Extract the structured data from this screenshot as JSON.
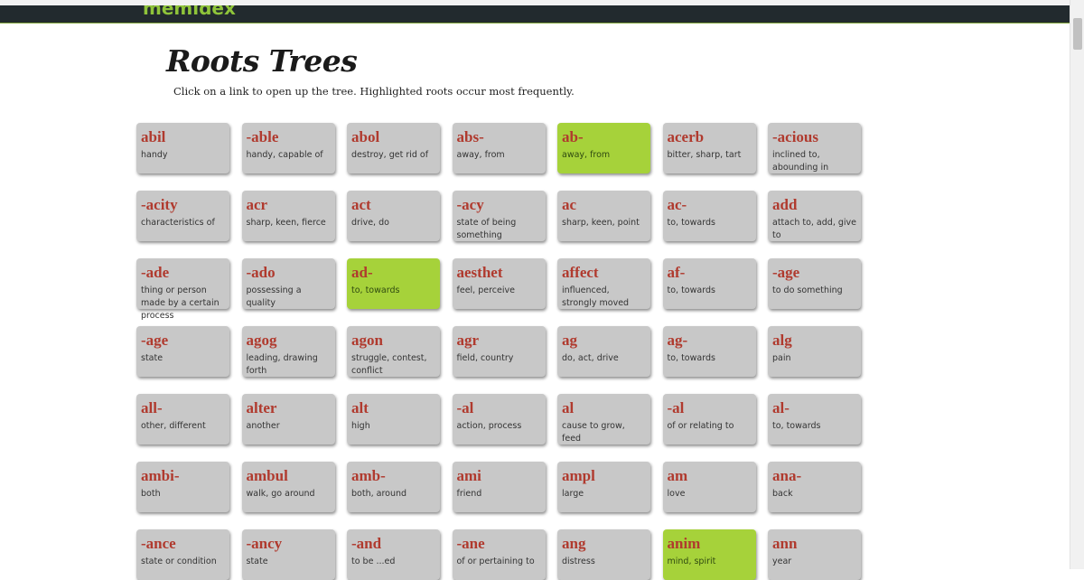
{
  "site": {
    "logo_text": "memidex"
  },
  "page": {
    "title": "Roots Trees",
    "instructions": "Click on a link to open up the tree. Highlighted roots occur most frequently."
  },
  "colors": {
    "card": "#c8c8c8",
    "highlight": "#a6d23a",
    "root_text": "#b03a2e",
    "topbar": "#222a2e"
  },
  "cards": [
    {
      "root": "abil",
      "meaning": "handy",
      "highlighted": false
    },
    {
      "root": "-able",
      "meaning": "handy, capable of",
      "highlighted": false
    },
    {
      "root": "abol",
      "meaning": "destroy, get rid of",
      "highlighted": false
    },
    {
      "root": "abs-",
      "meaning": "away, from",
      "highlighted": false
    },
    {
      "root": "ab-",
      "meaning": "away, from",
      "highlighted": true
    },
    {
      "root": "acerb",
      "meaning": "bitter, sharp, tart",
      "highlighted": false
    },
    {
      "root": "-acious",
      "meaning": "inclined to, abounding in",
      "highlighted": false
    },
    {
      "root": "-acity",
      "meaning": "characteristics of",
      "highlighted": false
    },
    {
      "root": "acr",
      "meaning": "sharp, keen, fierce",
      "highlighted": false
    },
    {
      "root": "act",
      "meaning": "drive, do",
      "highlighted": false
    },
    {
      "root": "-acy",
      "meaning": "state of being something",
      "highlighted": false
    },
    {
      "root": "ac",
      "meaning": "sharp, keen, point",
      "highlighted": false
    },
    {
      "root": "ac-",
      "meaning": "to, towards",
      "highlighted": false
    },
    {
      "root": "add",
      "meaning": "attach to, add, give to",
      "highlighted": false
    },
    {
      "root": "-ade",
      "meaning": "thing or person made by a certain process",
      "highlighted": false
    },
    {
      "root": "-ado",
      "meaning": "possessing a quality",
      "highlighted": false
    },
    {
      "root": "ad-",
      "meaning": "to, towards",
      "highlighted": true
    },
    {
      "root": "aesthet",
      "meaning": "feel, perceive",
      "highlighted": false
    },
    {
      "root": "affect",
      "meaning": "influenced, strongly moved",
      "highlighted": false
    },
    {
      "root": "af-",
      "meaning": "to, towards",
      "highlighted": false
    },
    {
      "root": "-age",
      "meaning": "to do something",
      "highlighted": false
    },
    {
      "root": "-age",
      "meaning": "state",
      "highlighted": false
    },
    {
      "root": "agog",
      "meaning": "leading, drawing forth",
      "highlighted": false
    },
    {
      "root": "agon",
      "meaning": "struggle, contest, conflict",
      "highlighted": false
    },
    {
      "root": "agr",
      "meaning": "field, country",
      "highlighted": false
    },
    {
      "root": "ag",
      "meaning": "do, act, drive",
      "highlighted": false
    },
    {
      "root": "ag-",
      "meaning": "to, towards",
      "highlighted": false
    },
    {
      "root": "alg",
      "meaning": "pain",
      "highlighted": false
    },
    {
      "root": "all-",
      "meaning": "other, different",
      "highlighted": false
    },
    {
      "root": "alter",
      "meaning": "another",
      "highlighted": false
    },
    {
      "root": "alt",
      "meaning": "high",
      "highlighted": false
    },
    {
      "root": "-al",
      "meaning": "action, process",
      "highlighted": false
    },
    {
      "root": "al",
      "meaning": "cause to grow, feed",
      "highlighted": false
    },
    {
      "root": "-al",
      "meaning": "of or relating to",
      "highlighted": false
    },
    {
      "root": "al-",
      "meaning": "to, towards",
      "highlighted": false
    },
    {
      "root": "ambi-",
      "meaning": "both",
      "highlighted": false
    },
    {
      "root": "ambul",
      "meaning": "walk, go around",
      "highlighted": false
    },
    {
      "root": "amb-",
      "meaning": "both, around",
      "highlighted": false
    },
    {
      "root": "ami",
      "meaning": "friend",
      "highlighted": false
    },
    {
      "root": "ampl",
      "meaning": "large",
      "highlighted": false
    },
    {
      "root": "am",
      "meaning": "love",
      "highlighted": false
    },
    {
      "root": "ana-",
      "meaning": "back",
      "highlighted": false
    },
    {
      "root": "-ance",
      "meaning": "state or condition",
      "highlighted": false
    },
    {
      "root": "-ancy",
      "meaning": "state",
      "highlighted": false
    },
    {
      "root": "-and",
      "meaning": "to be ...ed",
      "highlighted": false
    },
    {
      "root": "-ane",
      "meaning": "of or pertaining to",
      "highlighted": false
    },
    {
      "root": "ang",
      "meaning": "distress",
      "highlighted": false
    },
    {
      "root": "anim",
      "meaning": "mind, spirit",
      "highlighted": true
    },
    {
      "root": "ann",
      "meaning": "year",
      "highlighted": false
    }
  ]
}
